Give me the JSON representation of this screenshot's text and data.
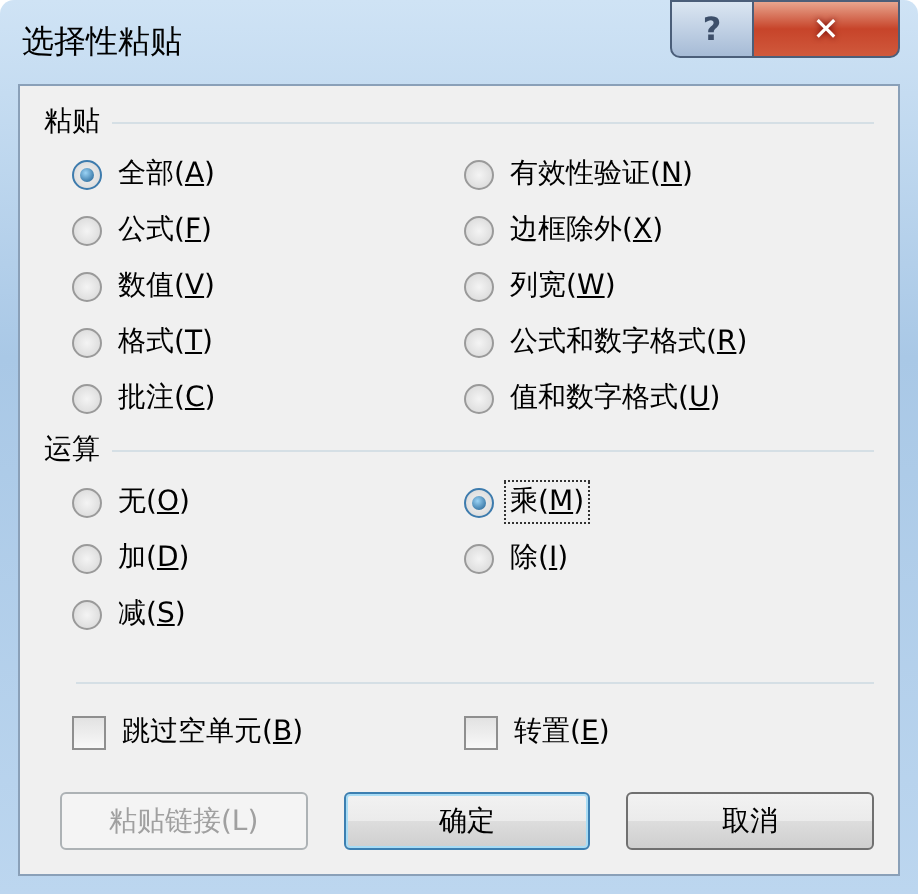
{
  "window": {
    "title": "选择性粘贴",
    "help_label": "?",
    "close_label": "✕"
  },
  "paste": {
    "heading": "粘贴",
    "options": [
      {
        "text": "全部(",
        "accesskey": "A",
        "tail": ")",
        "selected": true,
        "focused": false
      },
      {
        "text": "公式(",
        "accesskey": "F",
        "tail": ")",
        "selected": false,
        "focused": false
      },
      {
        "text": "数值(",
        "accesskey": "V",
        "tail": ")",
        "selected": false,
        "focused": false
      },
      {
        "text": "格式(",
        "accesskey": "T",
        "tail": ")",
        "selected": false,
        "focused": false
      },
      {
        "text": "批注(",
        "accesskey": "C",
        "tail": ")",
        "selected": false,
        "focused": false
      },
      {
        "text": "有效性验证(",
        "accesskey": "N",
        "tail": ")",
        "selected": false,
        "focused": false
      },
      {
        "text": "边框除外(",
        "accesskey": "X",
        "tail": ")",
        "selected": false,
        "focused": false
      },
      {
        "text": "列宽(",
        "accesskey": "W",
        "tail": ")",
        "selected": false,
        "focused": false
      },
      {
        "text": "公式和数字格式(",
        "accesskey": "R",
        "tail": ")",
        "selected": false,
        "focused": false
      },
      {
        "text": "值和数字格式(",
        "accesskey": "U",
        "tail": ")",
        "selected": false,
        "focused": false
      }
    ]
  },
  "operation": {
    "heading": "运算",
    "options": [
      {
        "text": "无(",
        "accesskey": "O",
        "tail": ")",
        "selected": false,
        "focused": false
      },
      {
        "text": "加(",
        "accesskey": "D",
        "tail": ")",
        "selected": false,
        "focused": false
      },
      {
        "text": "减(",
        "accesskey": "S",
        "tail": ")",
        "selected": false,
        "focused": false
      },
      {
        "text": "乘(",
        "accesskey": "M",
        "tail": ")",
        "selected": true,
        "focused": true
      },
      {
        "text": "除(",
        "accesskey": "I",
        "tail": ")",
        "selected": false,
        "focused": false
      }
    ]
  },
  "checkboxes": [
    {
      "text": "跳过空单元(",
      "accesskey": "B",
      "tail": ")",
      "checked": false
    },
    {
      "text": "转置(",
      "accesskey": "E",
      "tail": ")",
      "checked": false
    }
  ],
  "buttons": [
    {
      "label": "粘贴链接(L)",
      "disabled": true,
      "default": false
    },
    {
      "label": "确定",
      "disabled": false,
      "default": true
    },
    {
      "label": "取消",
      "disabled": false,
      "default": false
    }
  ]
}
